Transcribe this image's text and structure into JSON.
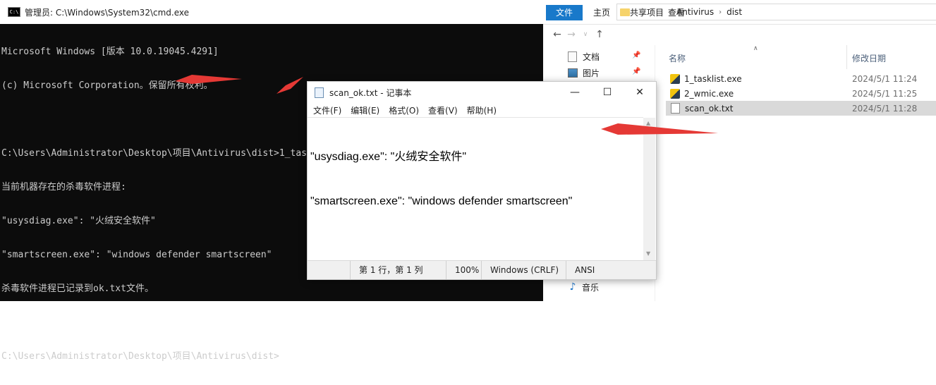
{
  "cmd": {
    "title": "管理员: C:\\Windows\\System32\\cmd.exe",
    "icon_text": "C:\\",
    "lines": [
      "Microsoft Windows [版本 10.0.19045.4291]",
      "(c) Microsoft Corporation。保留所有权利。",
      "",
      "C:\\Users\\Administrator\\Desktop\\项目\\Antivirus\\dist>1_tasklist.exe",
      "当前机器存在的杀毒软件进程:",
      "\"usysdiag.exe\": \"火绒安全软件\"",
      "\"smartscreen.exe\": \"windows defender smartscreen\"",
      "杀毒软件进程已记录到ok.txt文件。",
      "",
      "C:\\Users\\Administrator\\Desktop\\项目\\Antivirus\\dist>"
    ]
  },
  "explorer": {
    "ribbon_tabs": [
      "文件",
      "主页",
      "共享",
      "查看"
    ],
    "breadcrumb": [
      "项目",
      "Antivirus",
      "dist"
    ],
    "nav_items": [
      {
        "label": "文档",
        "icon": "document-icon"
      },
      {
        "label": "图片",
        "icon": "picture-icon"
      },
      {
        "label": "音乐",
        "icon": "music-icon"
      }
    ],
    "columns": {
      "name": "名称",
      "date": "修改日期"
    },
    "files": [
      {
        "name": "1_tasklist.exe",
        "date": "2024/5/1 11:24",
        "type": "exe"
      },
      {
        "name": "2_wmic.exe",
        "date": "2024/5/1 11:25",
        "type": "exe"
      },
      {
        "name": "scan_ok.txt",
        "date": "2024/5/1 11:28",
        "type": "txt",
        "selected": true
      }
    ]
  },
  "notepad": {
    "title": "scan_ok.txt - 记事本",
    "menus": [
      "文件(F)",
      "编辑(E)",
      "格式(O)",
      "查看(V)",
      "帮助(H)"
    ],
    "content_lines": [
      "\"usysdiag.exe\": \"火绒安全软件\"",
      "\"smartscreen.exe\": \"windows defender smartscreen\""
    ],
    "status": {
      "position": "第 1 行，第 1 列",
      "zoom": "100%",
      "eol": "Windows (CRLF)",
      "encoding": "ANSI"
    }
  },
  "colors": {
    "annotation_red": "#e53935",
    "ribbon_active": "#1979ca",
    "console_bg": "#0c0c0c",
    "console_fg": "#cccccc"
  }
}
